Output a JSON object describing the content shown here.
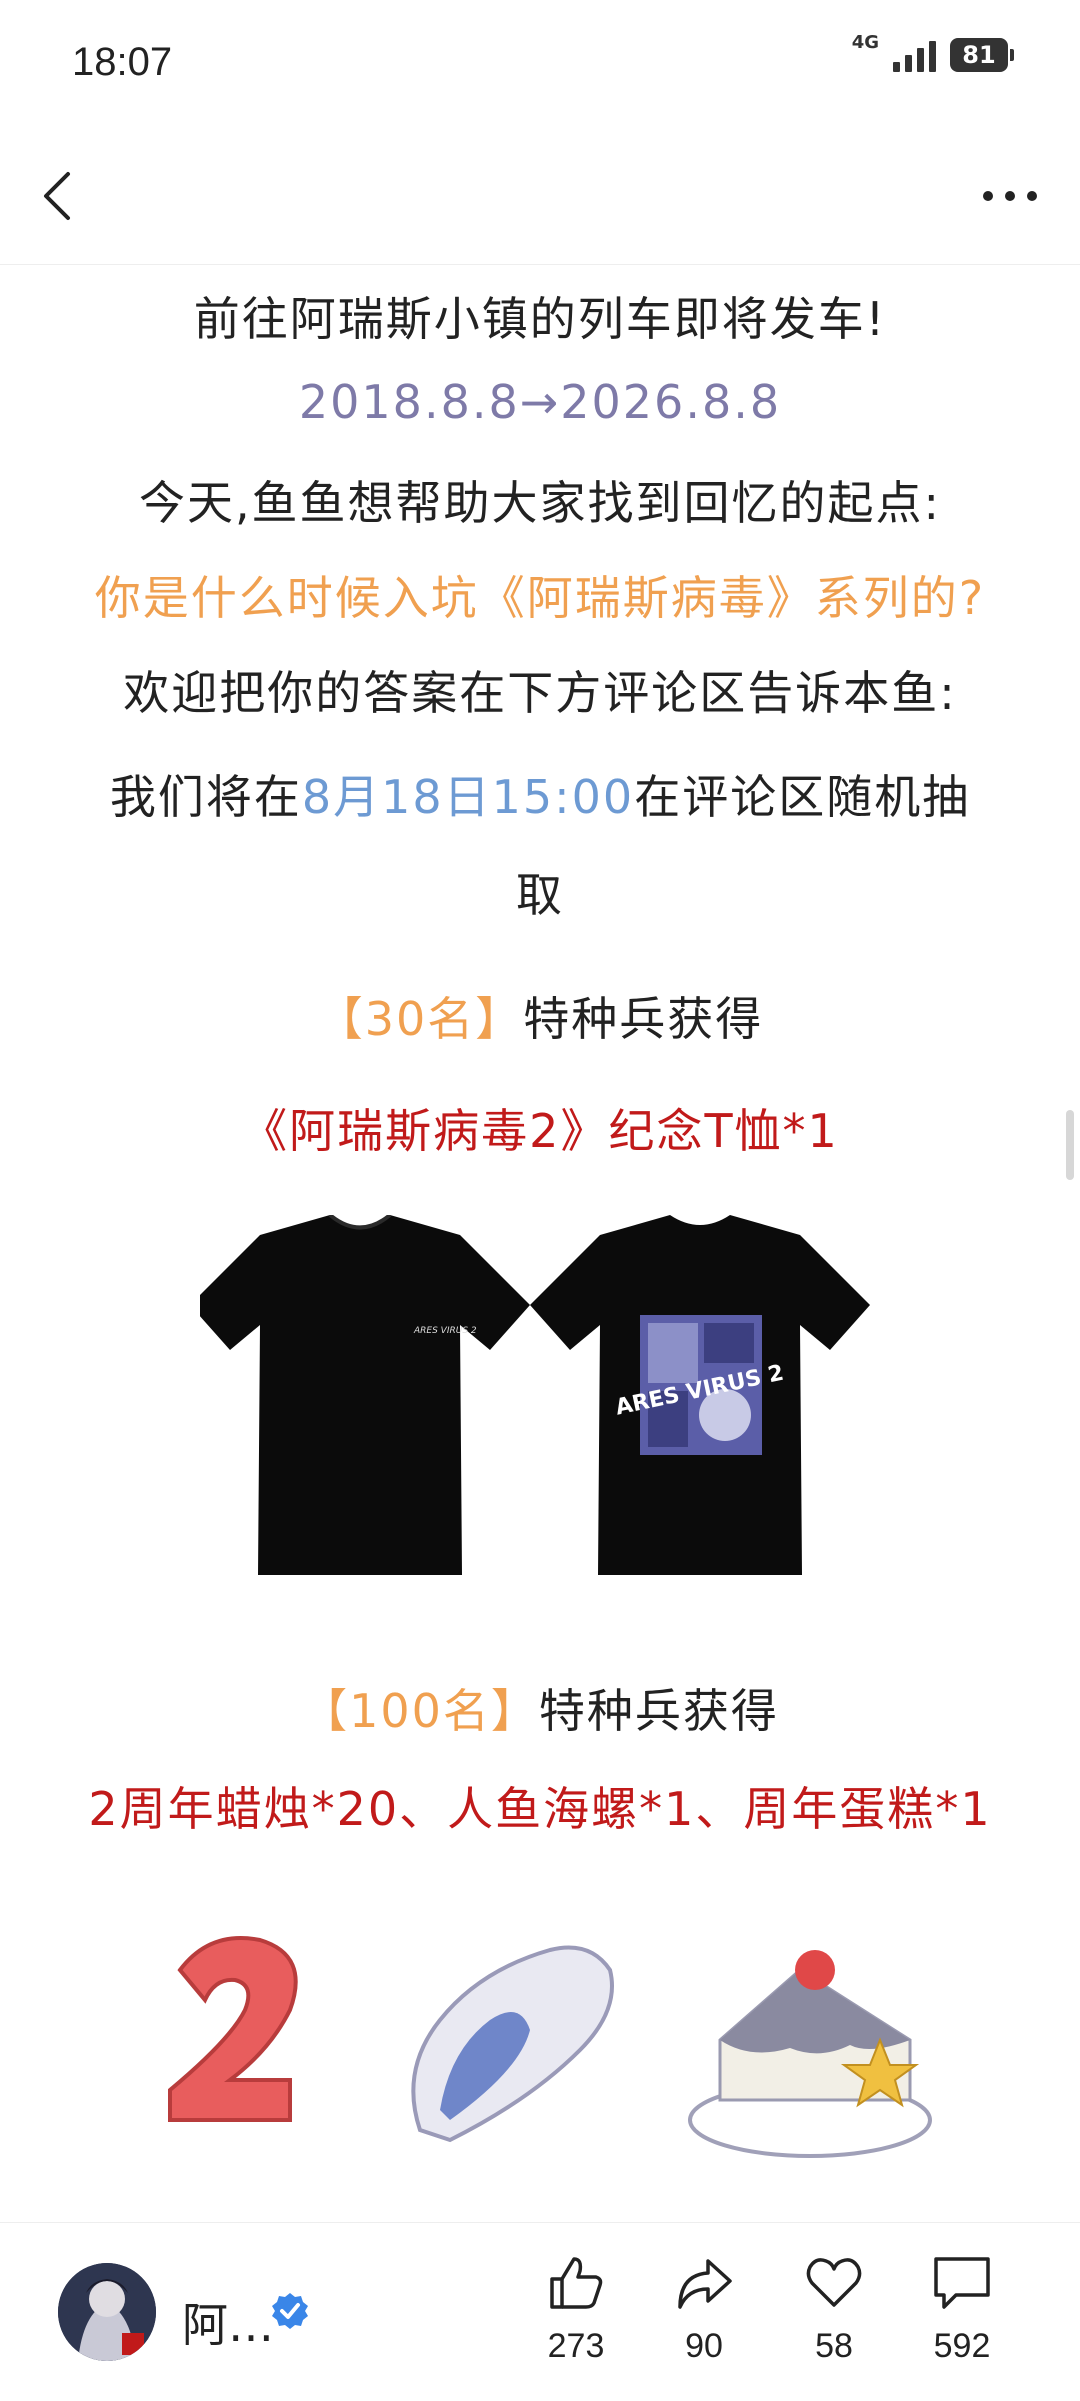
{
  "status_bar": {
    "time": "18:07",
    "network": "4G",
    "battery": "81"
  },
  "post": {
    "line1": "前往阿瑞斯小镇的列车即将发车!",
    "line2": "2018.8.8→2026.8.8",
    "line3": "今天,鱼鱼想帮助大家找到回忆的起点:",
    "line4": "你是什么时候入坑《阿瑞斯病毒》系列的?",
    "line5": "欢迎把你的答案在下方评论区告诉本鱼:",
    "line6_pre": "我们将在",
    "line6_time": "8月18日15:00",
    "line6_post": "在评论区随机抽",
    "line7": "取",
    "prize1_count": "【30名】",
    "prize1_text": "特种兵获得",
    "prize1_item": "《阿瑞斯病毒2》纪念T恤*1",
    "tshirt_logo": "ARES VIRUS 2",
    "prize2_count": "【100名】",
    "prize2_text": "特种兵获得",
    "prize2_items": "2周年蜡烛*20、人鱼海螺*1、周年蛋糕*1"
  },
  "bottom_bar": {
    "author_name": "阿…",
    "like_count": "273",
    "share_count": "90",
    "favorite_count": "58",
    "comment_count": "592"
  },
  "colors": {
    "orange": "#f0a050",
    "purple": "#7e7aa8",
    "blue": "#6d9ad3",
    "red": "#c11a1a"
  }
}
